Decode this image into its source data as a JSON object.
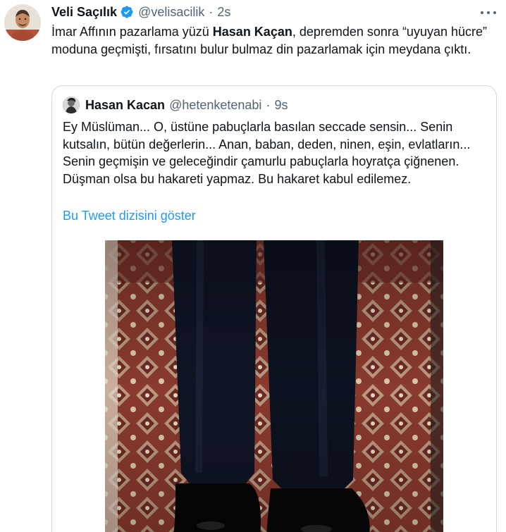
{
  "tweet": {
    "author_name": "Veli Saçılık",
    "author_handle": "@velisacilik",
    "separator": "·",
    "time": "2s",
    "avatar_icon": "profile-avatar",
    "verified_icon": "verified-badge-icon",
    "more_icon": "more-options-icon",
    "text_part1": "İmar Affının pazarlama yüzü ",
    "text_bold": "Hasan Kaçan",
    "text_part2": ", depremden sonra “uyuyan hücre” moduna geçmişti, fırsatını bulur bulmaz din pazarlamak için meydana çıktı."
  },
  "quoted": {
    "author_name": "Hasan Kacan",
    "author_handle": "@hetenketenabi",
    "separator": "·",
    "time": "9s",
    "text": "Ey Müslüman... O, üstüne pabuçlarla basılan seccade sensin... Senin kutsalın, bütün değerlerin... Anan, baban, deden, ninen, eşin, evlatların... Senin geçmişin ve geleceğindir çamurlu pabuçlarla hoyratça çiğnenen. Düşman olsa bu hakareti yapmaz. Bu hakaret kabul edilemez.",
    "thread_link": "Bu Tweet dizisini göster",
    "media_icon": "photo-shoes-on-prayer-rug"
  },
  "colors": {
    "accent": "#1d9bf0",
    "muted": "#536471",
    "border": "#cfd9de",
    "text": "#0f1419"
  }
}
